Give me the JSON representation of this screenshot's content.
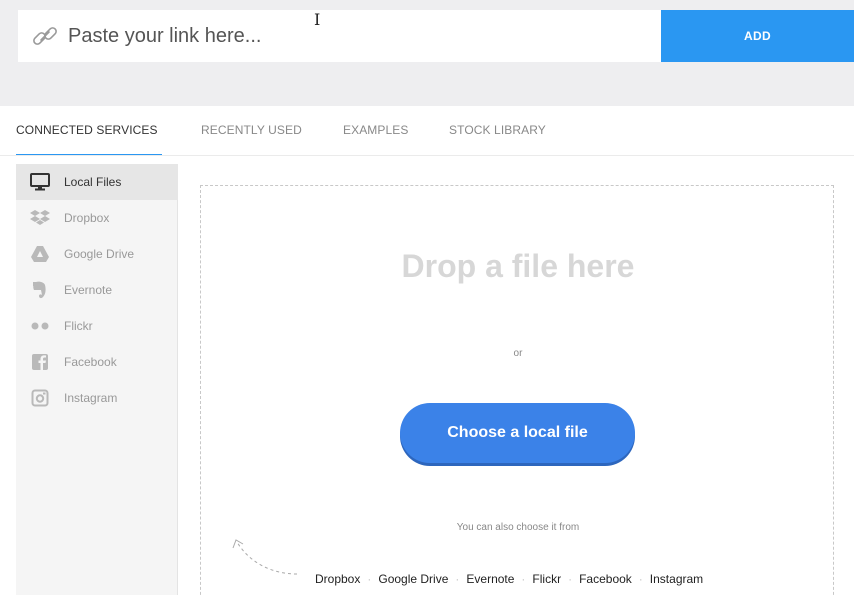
{
  "link_bar": {
    "placeholder": "Paste your link here...",
    "add_label": "ADD",
    "link_icon": "chain-link-icon",
    "cursor": "I"
  },
  "tabs": [
    {
      "label": "CONNECTED SERVICES",
      "active": true
    },
    {
      "label": "RECENTLY USED",
      "active": false
    },
    {
      "label": "EXAMPLES",
      "active": false
    },
    {
      "label": "STOCK LIBRARY",
      "active": false
    }
  ],
  "sidebar": {
    "items": [
      {
        "label": "Local Files",
        "icon": "monitor-icon",
        "active": true
      },
      {
        "label": "Dropbox",
        "icon": "dropbox-icon",
        "active": false
      },
      {
        "label": "Google Drive",
        "icon": "google-drive-icon",
        "active": false
      },
      {
        "label": "Evernote",
        "icon": "evernote-icon",
        "active": false
      },
      {
        "label": "Flickr",
        "icon": "flickr-icon",
        "active": false
      },
      {
        "label": "Facebook",
        "icon": "facebook-icon",
        "active": false
      },
      {
        "label": "Instagram",
        "icon": "instagram-icon",
        "active": false
      }
    ]
  },
  "dropzone": {
    "title": "Drop a file here",
    "or": "or",
    "choose_label": "Choose a local file",
    "also_text": "You can also choose it from",
    "sources": [
      "Dropbox",
      "Google Drive",
      "Evernote",
      "Flickr",
      "Facebook",
      "Instagram"
    ]
  },
  "colors": {
    "accent": "#2a97f2",
    "choose_button": "#3b82e8",
    "topbar_bg": "#eeeef0"
  }
}
